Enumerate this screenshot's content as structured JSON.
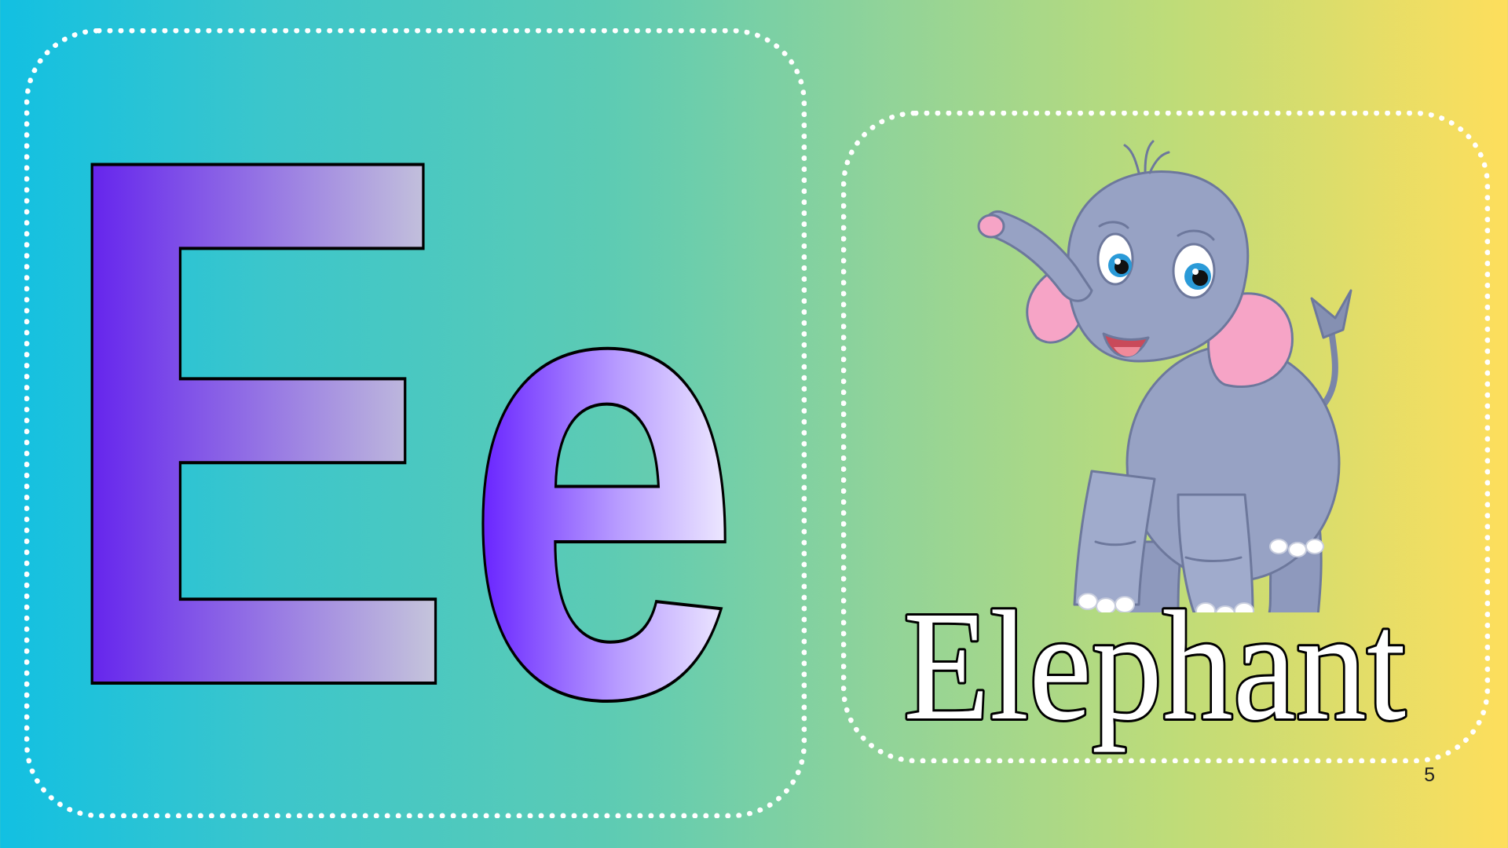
{
  "slide": {
    "letter_upper": "E",
    "letter_lower": "e",
    "word": "Elephant",
    "page_number": "5",
    "picture_icon": "elephant-icon"
  },
  "colors": {
    "background_start": "#12c0e2",
    "background_end": "#fede5c",
    "letter_dark": "#5a12ef",
    "letter_light": "#ccd0da",
    "lower_letter_light": "#f4f2fe",
    "dotted_border": "#ffffff",
    "elephant_body": "#97a2c4",
    "elephant_ear": "#f6a4c6"
  }
}
